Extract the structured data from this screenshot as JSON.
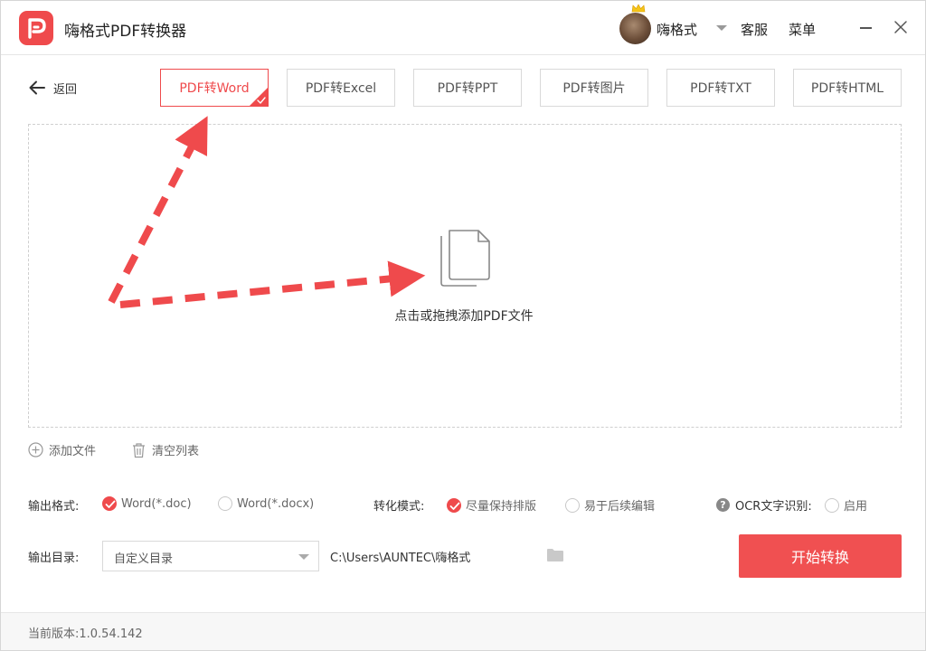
{
  "app": {
    "title": "嗨格式PDF转换器",
    "accent_color": "#ef4a4c"
  },
  "header": {
    "username": "嗨格式",
    "service": "客服",
    "menu": "菜单"
  },
  "toolbar": {
    "back_label": "返回",
    "tabs": [
      {
        "label": "PDF转Word",
        "active": true
      },
      {
        "label": "PDF转Excel",
        "active": false
      },
      {
        "label": "PDF转PPT",
        "active": false
      },
      {
        "label": "PDF转图片",
        "active": false
      },
      {
        "label": "PDF转TXT",
        "active": false
      },
      {
        "label": "PDF转HTML",
        "active": false
      }
    ]
  },
  "dropzone": {
    "hint": "点击或拖拽添加PDF文件"
  },
  "file_actions": {
    "add_file": "添加文件",
    "clear_list": "清空列表"
  },
  "options": {
    "output_format_label": "输出格式:",
    "formats": [
      {
        "label": "Word(*.doc)",
        "checked": true
      },
      {
        "label": "Word(*.docx)",
        "checked": false
      }
    ],
    "mode_label": "转化模式:",
    "modes": [
      {
        "label": "尽量保持排版",
        "checked": true
      },
      {
        "label": "易于后续编辑",
        "checked": false
      }
    ],
    "ocr_label": "OCR文字识别:",
    "ocr_option": {
      "label": "启用",
      "checked": false
    },
    "help_glyph": "?"
  },
  "output": {
    "dir_label": "输出目录:",
    "dir_select_value": "自定义目录",
    "dir_path": "C:\\Users\\AUNTEC\\嗨格式",
    "start_button": "开始转换"
  },
  "footer": {
    "version_label": "当前版本:1.0.54.142"
  },
  "icons": {
    "logo": "pdf-logo-icon",
    "back": "arrow-left-icon",
    "file": "document-stack-icon",
    "add": "plus-circle-icon",
    "clear": "trash-icon",
    "folder": "folder-icon",
    "close": "close-icon",
    "minimize": "minimize-icon",
    "crown": "crown-icon"
  }
}
